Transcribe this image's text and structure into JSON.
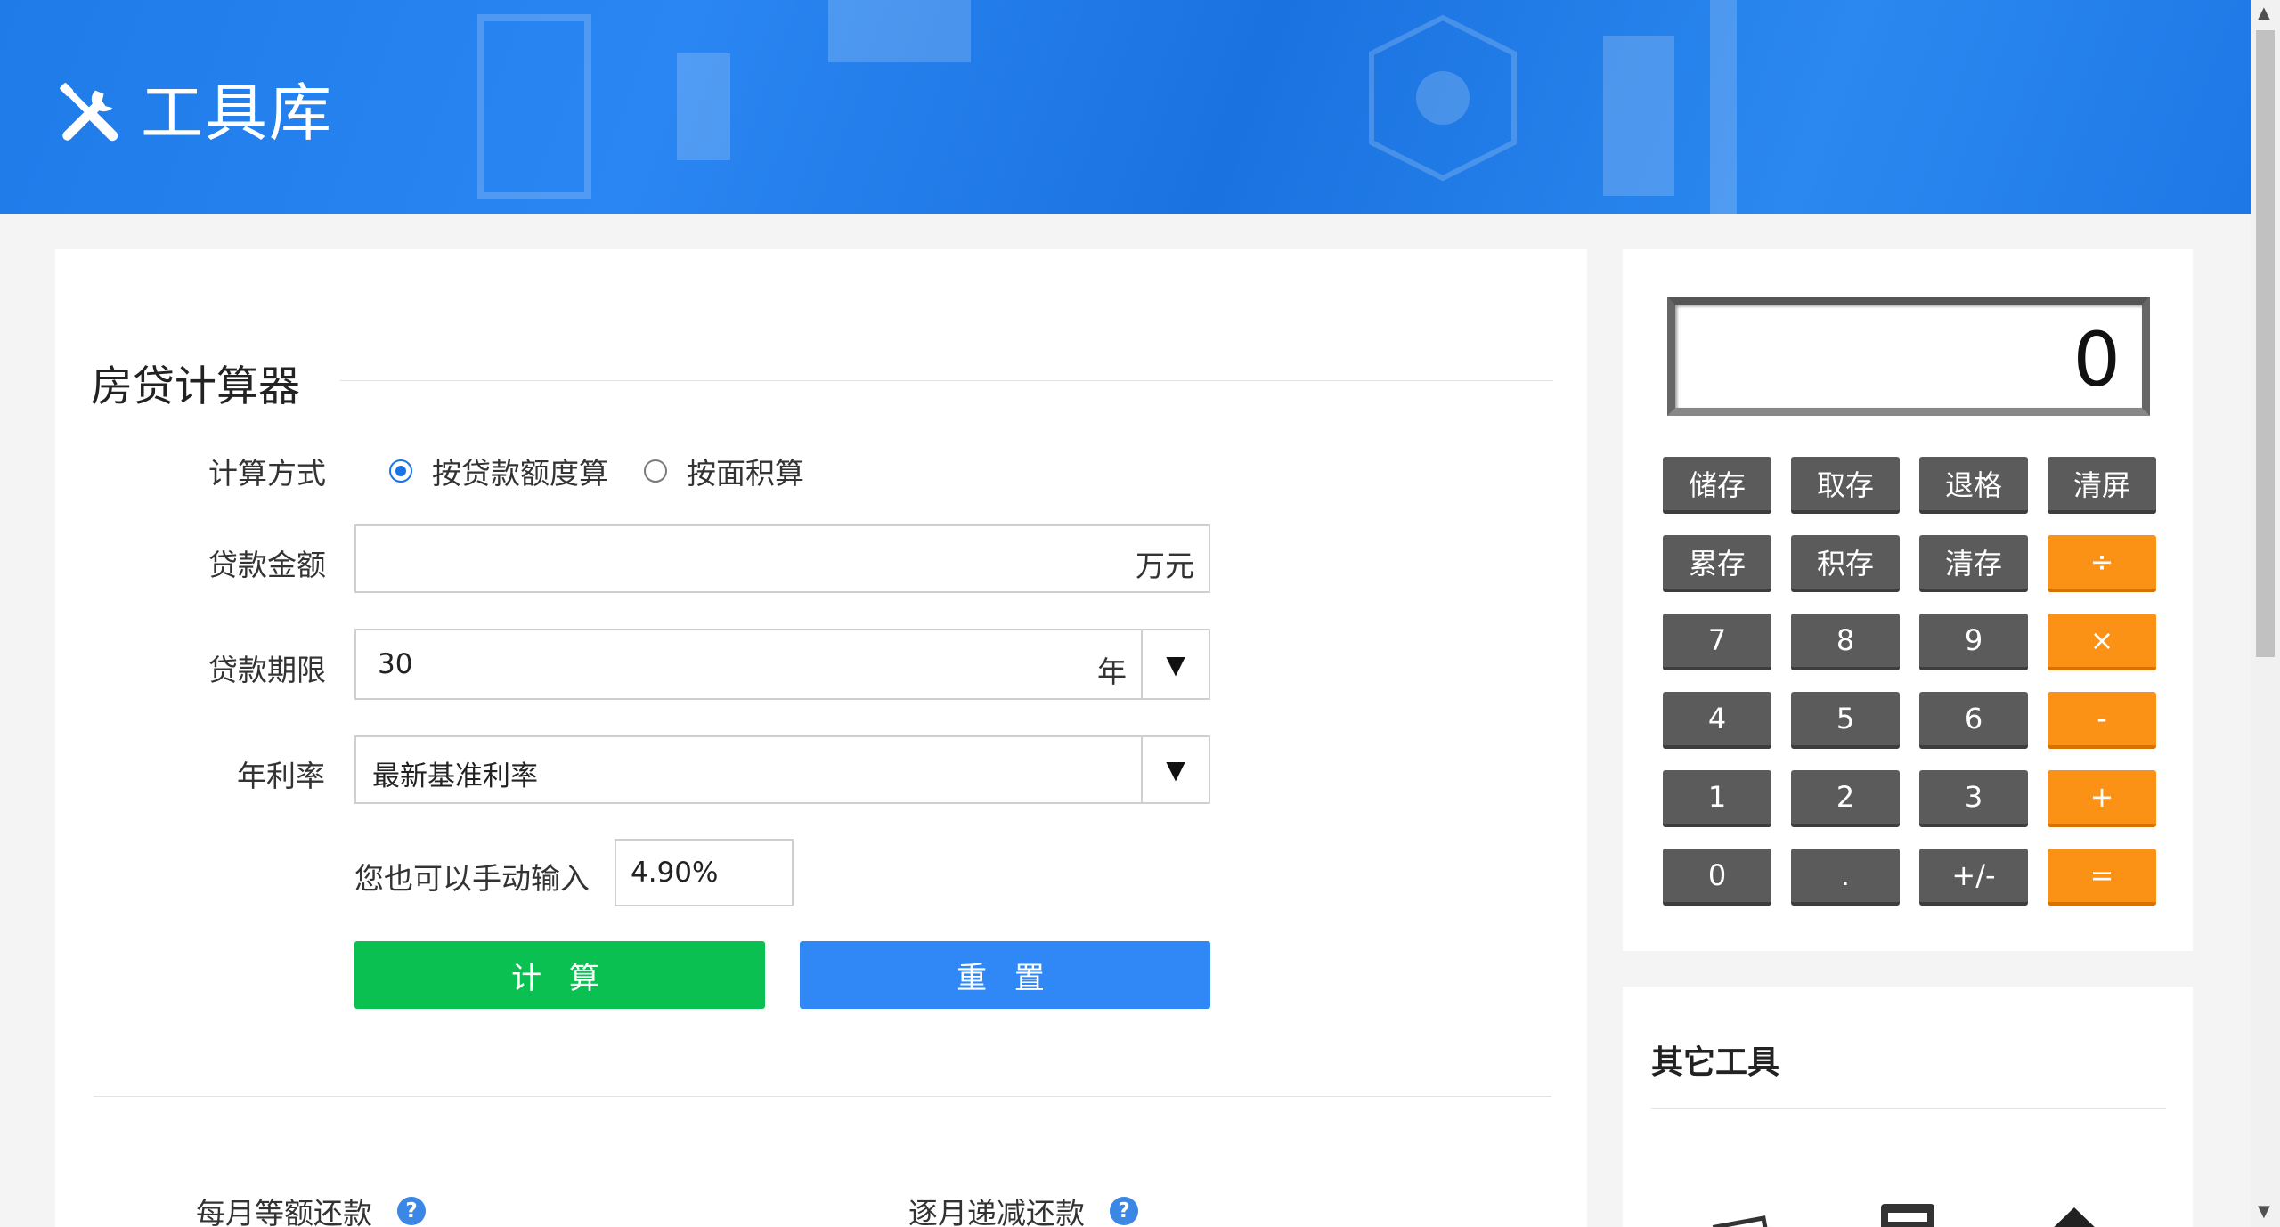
{
  "header": {
    "title": "工具库",
    "logo_icon": "tools-icon",
    "bg_color": "#2a86f2"
  },
  "loan": {
    "title": "房贷计算器",
    "method": {
      "label": "计算方式",
      "options": [
        {
          "label": "按贷款额度算",
          "selected": true
        },
        {
          "label": "按面积算",
          "selected": false
        }
      ]
    },
    "amount": {
      "label": "贷款金额",
      "value": "",
      "unit": "万元"
    },
    "term": {
      "label": "贷款期限",
      "value": "30",
      "unit": "年"
    },
    "rate": {
      "label": "年利率",
      "value": "最新基准利率"
    },
    "manual": {
      "label": "您也可以手动输入",
      "value": "4.90%"
    },
    "calc_button": "计 算",
    "reset_button": "重 置",
    "result_tabs": [
      {
        "label": "每月等额还款"
      },
      {
        "label": "逐月递减还款"
      }
    ],
    "help_glyph": "?",
    "accent_green": "#0ac051",
    "accent_blue": "#2f88f5"
  },
  "calculator": {
    "display": "0",
    "keys": [
      [
        "储存",
        "取存",
        "退格",
        "清屏"
      ],
      [
        "累存",
        "积存",
        "清存",
        "÷"
      ],
      [
        "7",
        "8",
        "9",
        "×"
      ],
      [
        "4",
        "5",
        "6",
        "-"
      ],
      [
        "1",
        "2",
        "3",
        "+"
      ],
      [
        "0",
        ".",
        "+/-",
        "="
      ]
    ],
    "key_color": "#5b5b5b",
    "operator_color": "#fb9216"
  },
  "other_tools": {
    "title": "其它工具"
  }
}
